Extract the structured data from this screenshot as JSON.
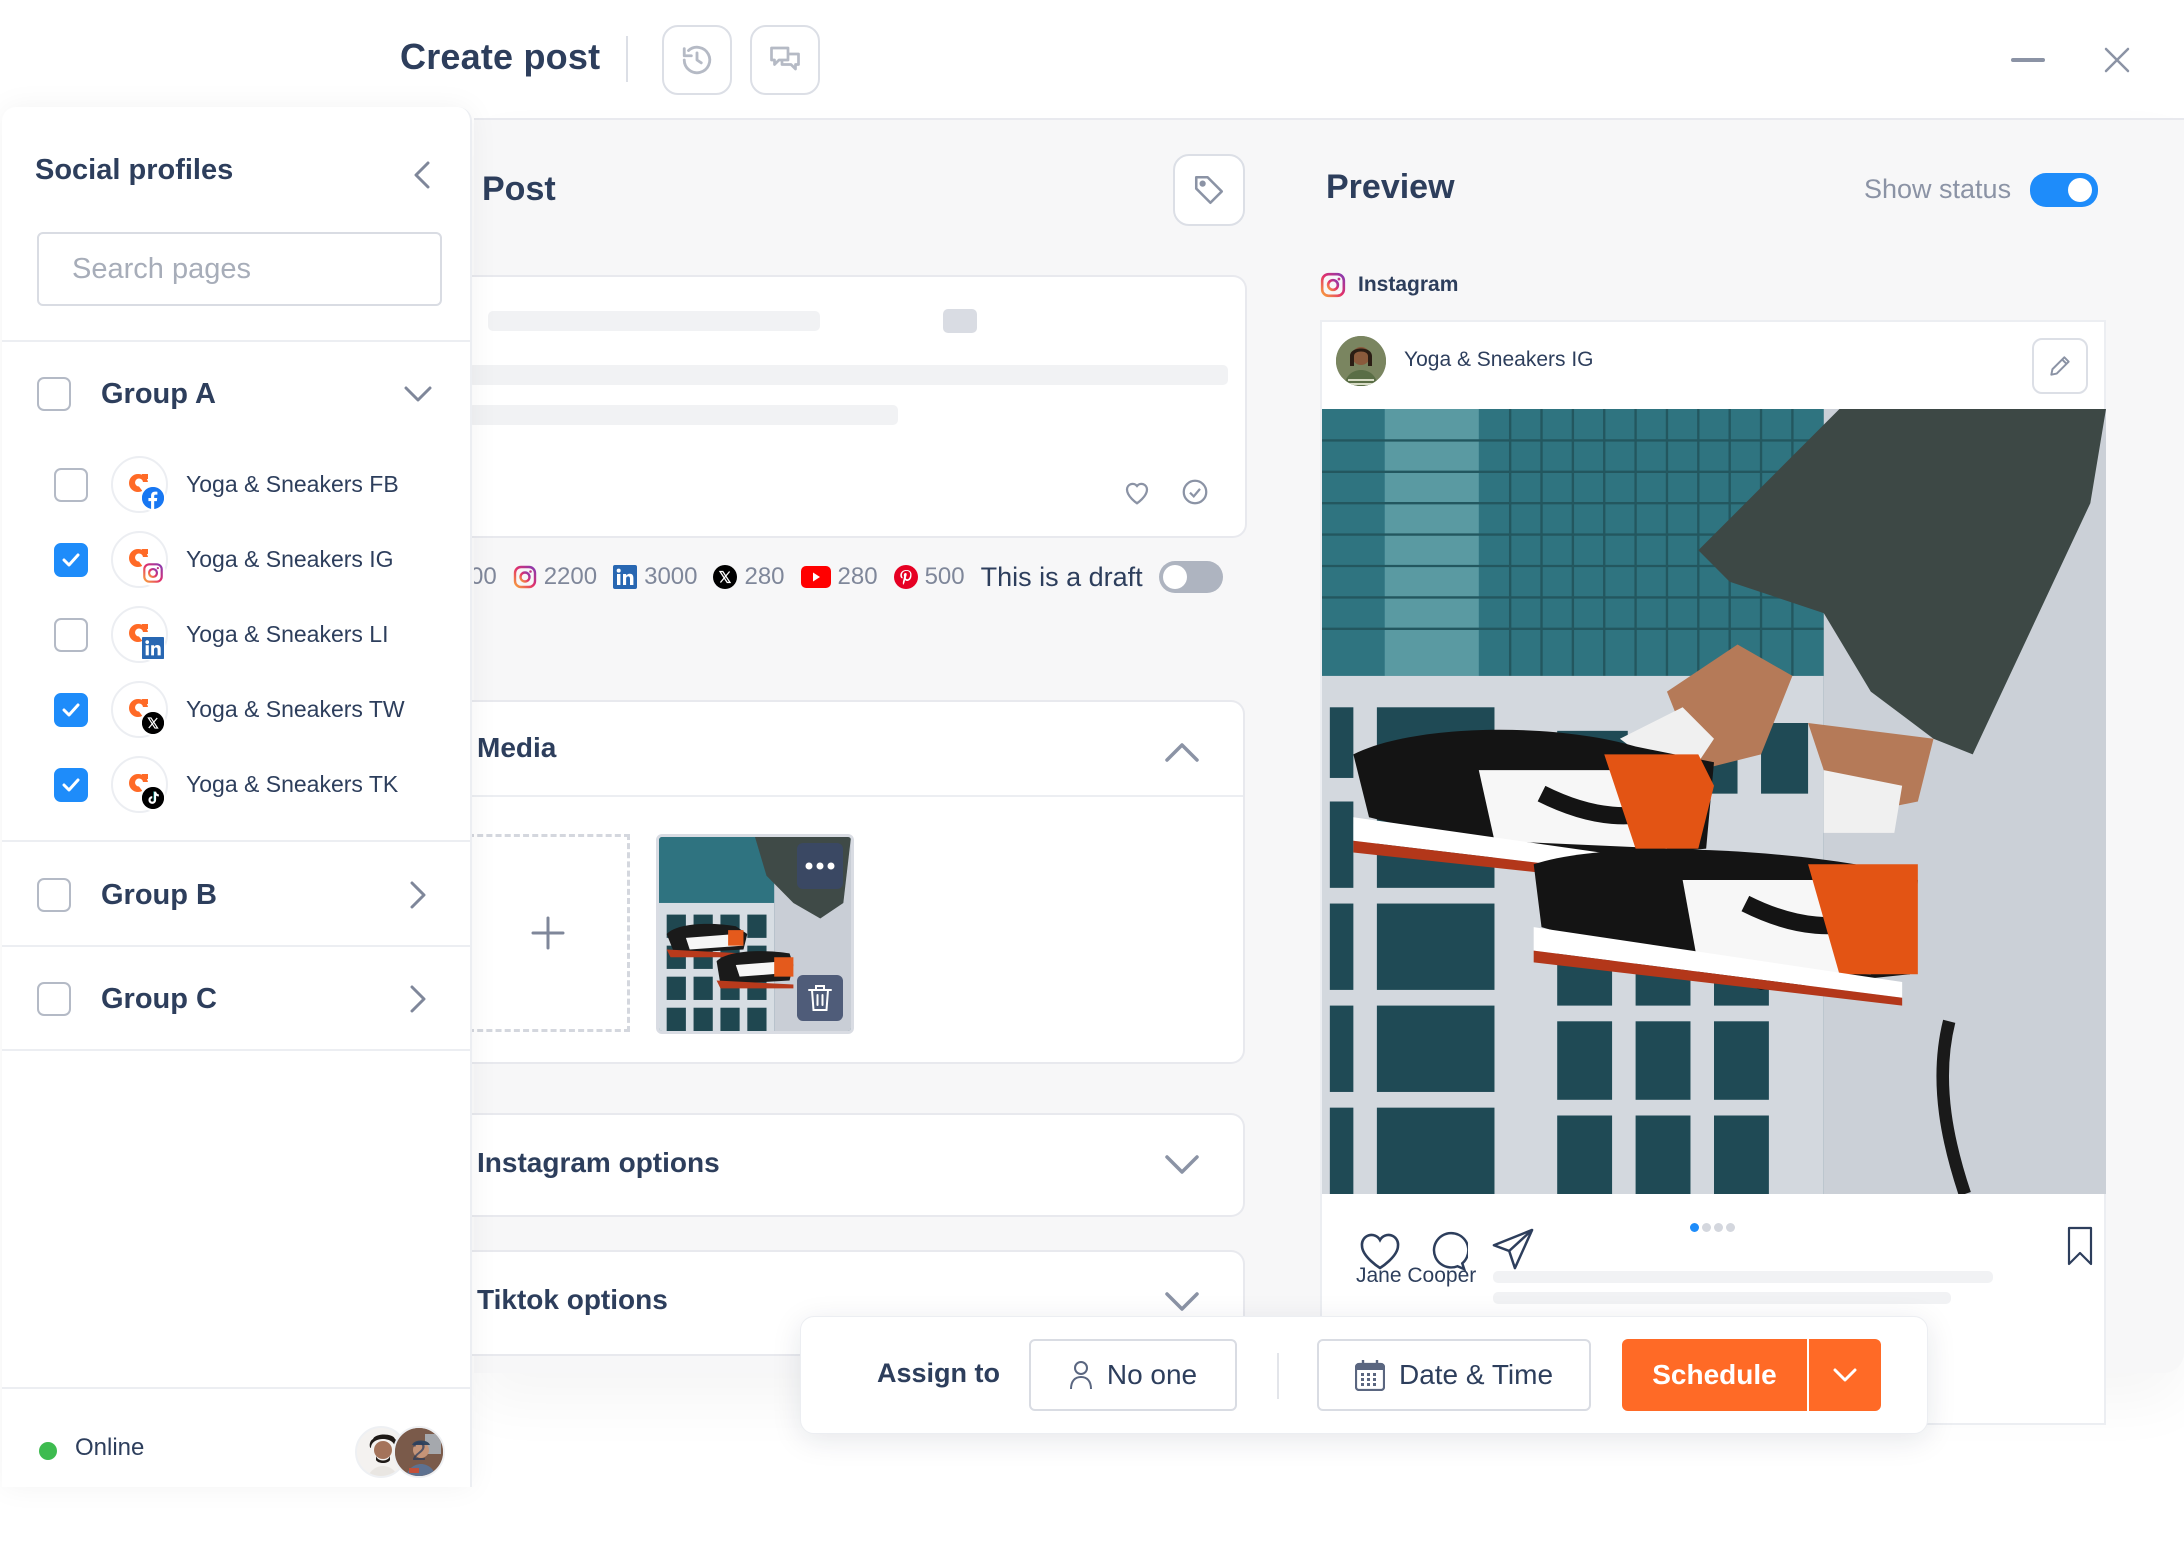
{
  "header": {
    "title": "Create post",
    "history_icon": "history-icon",
    "comments_icon": "comments-icon",
    "minimize_icon": "minimize-icon",
    "close_icon": "close-icon"
  },
  "sidebar": {
    "title": "Social profiles",
    "collapse_icon": "chevron-left-icon",
    "search": {
      "placeholder": "Search pages",
      "value": ""
    },
    "groups": [
      {
        "label": "Group A",
        "checked": false,
        "expanded": true,
        "profiles": [
          {
            "label": "Yoga & Sneakers FB",
            "network": "facebook",
            "checked": false
          },
          {
            "label": "Yoga & Sneakers IG",
            "network": "instagram",
            "checked": true
          },
          {
            "label": "Yoga & Sneakers LI",
            "network": "linkedin",
            "checked": false
          },
          {
            "label": "Yoga & Sneakers TW",
            "network": "x",
            "checked": true
          },
          {
            "label": "Yoga & Sneakers TK",
            "network": "tiktok",
            "checked": true
          }
        ]
      },
      {
        "label": "Group B",
        "checked": false,
        "expanded": false
      },
      {
        "label": "Group C",
        "checked": false,
        "expanded": false
      }
    ],
    "footer": {
      "status": "Online",
      "status_color": "#3dbb4f",
      "team_count": "2"
    }
  },
  "post": {
    "title": "Post",
    "tag_icon": "tag-icon",
    "editor_icons": [
      "heart-icon",
      "check-circle-icon"
    ],
    "char_counters": [
      {
        "network": "facebook",
        "limit": "00"
      },
      {
        "network": "instagram",
        "limit": "2200"
      },
      {
        "network": "linkedin",
        "limit": "3000"
      },
      {
        "network": "x",
        "limit": "280"
      },
      {
        "network": "youtube",
        "limit": "280"
      },
      {
        "network": "pinterest",
        "limit": "500"
      }
    ],
    "draft_label": "This is a draft",
    "draft_on": false,
    "media": {
      "title": "Media",
      "add_icon": "plus-icon",
      "item_menu_icon": "more-horizontal-icon",
      "item_delete_icon": "trash-icon"
    },
    "sections": [
      {
        "title": "Instagram options",
        "expanded": false
      },
      {
        "title": "Tiktok options",
        "expanded": false
      }
    ]
  },
  "preview": {
    "title": "Preview",
    "show_status_label": "Show status",
    "show_status_on": true,
    "network_label": "Instagram",
    "account_name": "Yoga & Sneakers IG",
    "edit_icon": "pencil-icon",
    "carousel_count": 4,
    "carousel_active": 1,
    "caption_author": "Jane Cooper"
  },
  "action_bar": {
    "assign_label": "Assign to",
    "assignee": "No one",
    "date_time_label": "Date & Time",
    "schedule_label": "Schedule"
  },
  "colors": {
    "accent": "#1e8cfa",
    "primary_action": "#ff6a26",
    "text": "#2d3e5c",
    "muted": "#7f879a"
  }
}
